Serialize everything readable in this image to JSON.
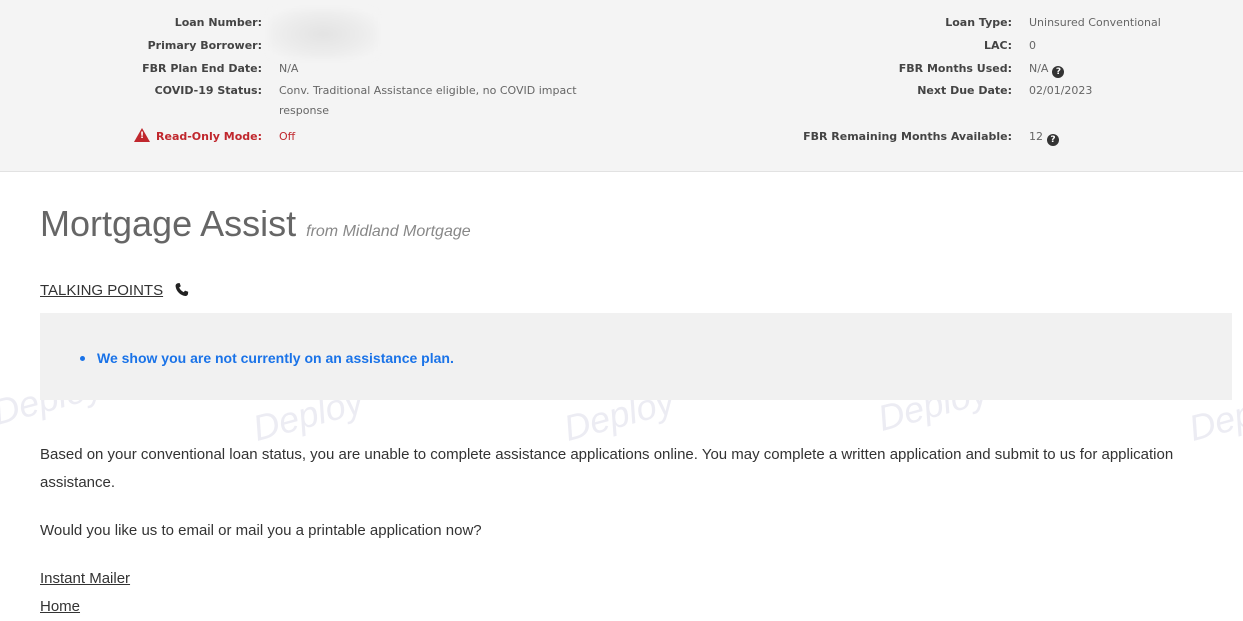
{
  "loan_info": {
    "left": [
      {
        "label": "Loan Number:",
        "value": ""
      },
      {
        "label": "Primary Borrower:",
        "value": ""
      },
      {
        "label": "FBR Plan End Date:",
        "value": "N/A"
      },
      {
        "label": "COVID-19 Status:",
        "value": "Conv. Traditional Assistance eligible, no COVID impact",
        "value_line2": "response"
      },
      {
        "label": "Read-Only Mode:",
        "value": "Off"
      }
    ],
    "right": [
      {
        "label": "Loan Type:",
        "value": "Uninsured Conventional"
      },
      {
        "label": "LAC:",
        "value": "0"
      },
      {
        "label": "FBR Months Used:",
        "value": "N/A"
      },
      {
        "label": "Next Due Date:",
        "value": "02/01/2023"
      },
      {
        "label": "FBR Remaining Months Available:",
        "value": "12"
      }
    ],
    "help_glyph": "?",
    "warning_glyph": "!"
  },
  "main": {
    "title": "Mortgage Assist",
    "subtitle": "from Midland Mortgage",
    "talking_points_label": "TALKING POINTS",
    "assist_message": "We show you are not currently on an assistance plan.",
    "paragraph1": "Based on your conventional loan status, you are unable to complete assistance applications online. You may complete a written application and submit to us for application assistance.",
    "paragraph2": "Would you like us to email or mail you a printable application now?",
    "link_instant_mailer": "Instant Mailer",
    "link_home": "Home"
  },
  "watermark_text": "Deploy",
  "colors": {
    "panel_bg": "#f4f4f4",
    "accent_blue": "#1a73e8",
    "warning_red": "#c0272d"
  },
  "icons": {
    "phone": "phone-icon",
    "help": "question-circle-icon",
    "warning": "warning-triangle-icon"
  }
}
